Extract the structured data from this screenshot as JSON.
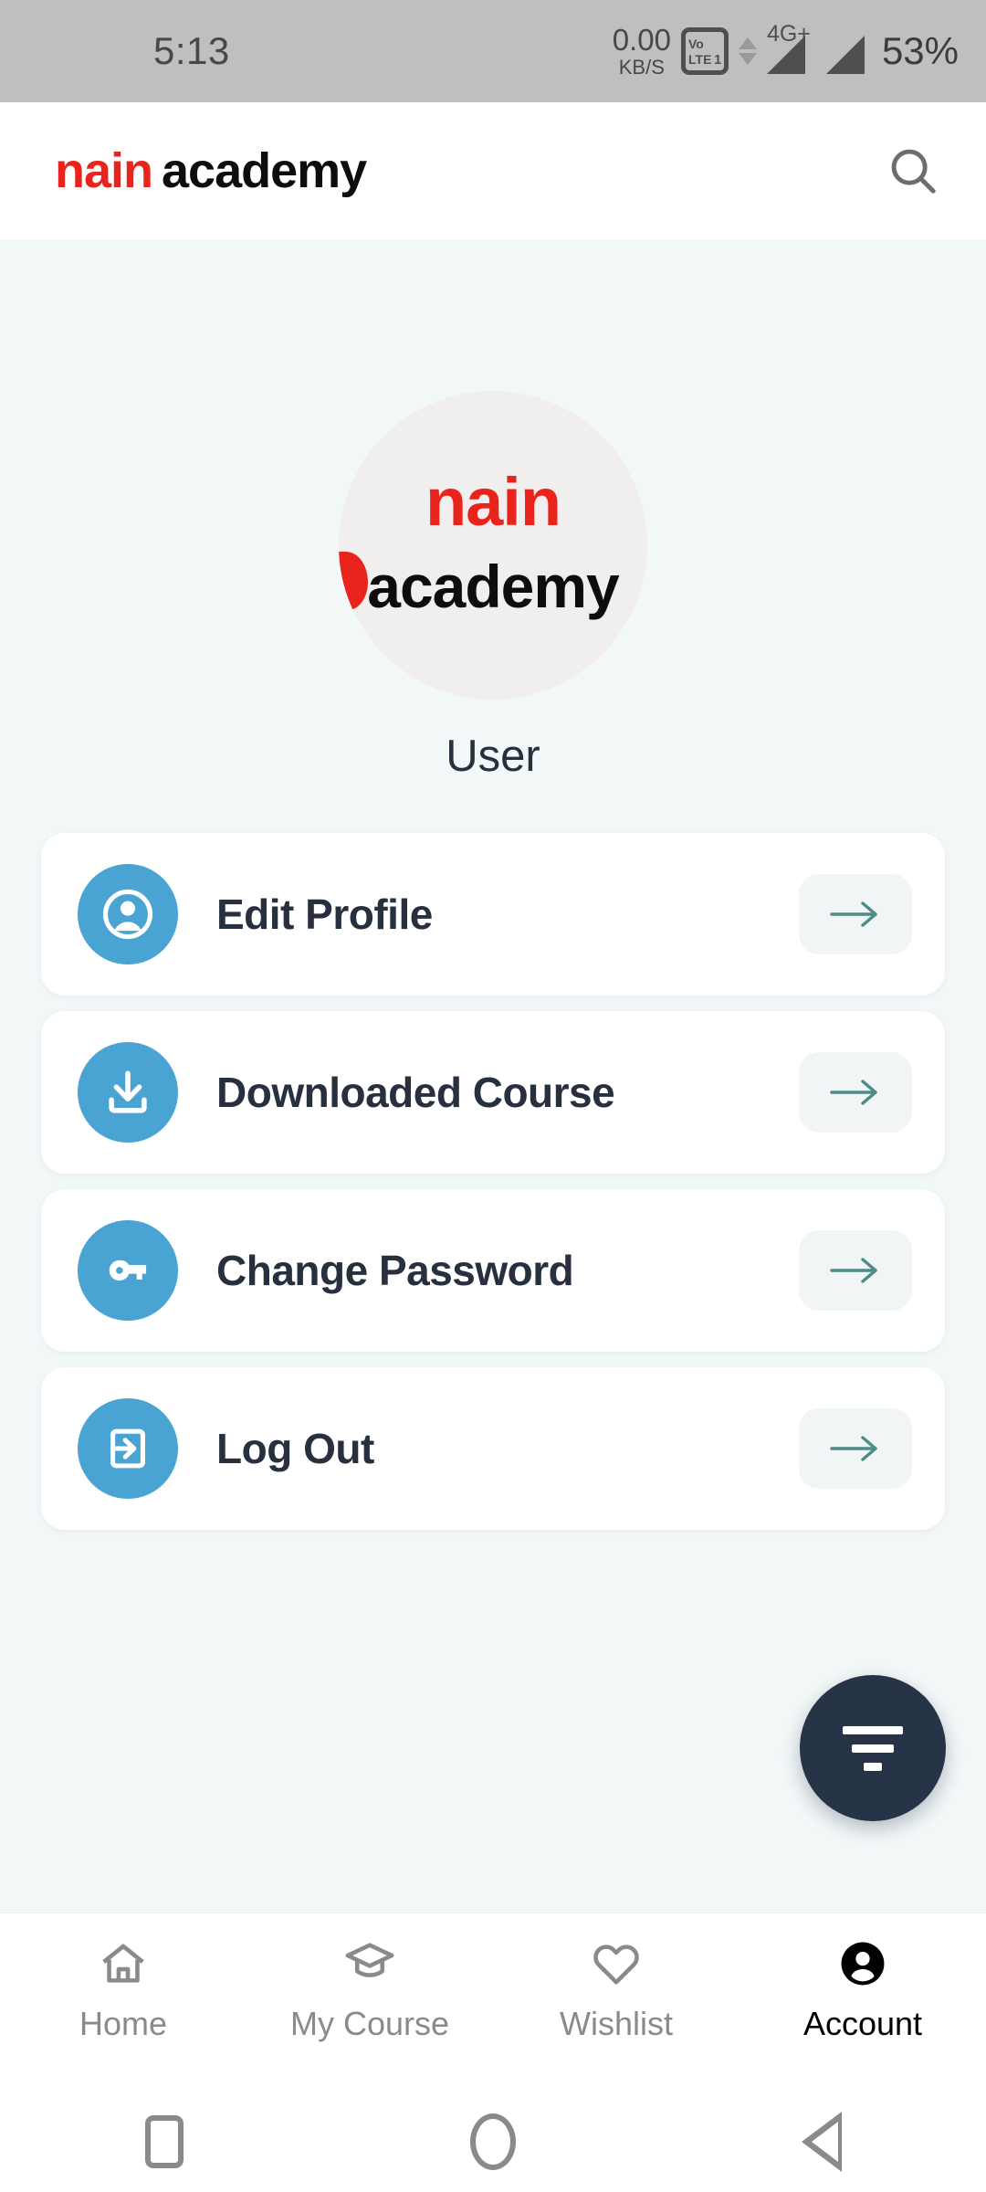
{
  "status_bar": {
    "time": "5:13",
    "net_speed_value": "0.00",
    "net_speed_unit": "KB/S",
    "volte_label": "VoLTE",
    "sim_index": "1",
    "network_type": "4G+",
    "battery": "53%"
  },
  "header": {
    "brand_primary": "nain",
    "brand_secondary": "academy",
    "search_icon": "search-icon"
  },
  "profile": {
    "avatar_brand_primary": "nain",
    "avatar_brand_secondary": "academy",
    "user_name": "User"
  },
  "menu": {
    "items": [
      {
        "label": "Edit Profile",
        "icon": "person-circle-icon",
        "arrow_icon": "arrow-right-icon"
      },
      {
        "label": "Downloaded Course",
        "icon": "download-icon",
        "arrow_icon": "arrow-right-icon"
      },
      {
        "label": "Change Password",
        "icon": "key-icon",
        "arrow_icon": "arrow-right-icon"
      },
      {
        "label": "Log Out",
        "icon": "logout-icon",
        "arrow_icon": "arrow-right-icon"
      }
    ]
  },
  "fab": {
    "icon": "filter-icon"
  },
  "bottom_nav": {
    "items": [
      {
        "label": "Home",
        "icon": "home-icon",
        "active": false
      },
      {
        "label": "My Course",
        "icon": "graduation-cap-icon",
        "active": false
      },
      {
        "label": "Wishlist",
        "icon": "heart-icon",
        "active": false
      },
      {
        "label": "Account",
        "icon": "person-filled-icon",
        "active": true
      }
    ]
  },
  "system_nav": {
    "recents_icon": "square-recents-icon",
    "home_icon": "circle-home-icon",
    "back_icon": "triangle-back-icon"
  },
  "colors": {
    "brand_red": "#e8241c",
    "icon_blue": "#4aa4d3",
    "arrow_teal": "#4c8c87",
    "fab_navy": "#273447",
    "text_navy": "#27303f",
    "page_bg": "#f2f7f8"
  }
}
